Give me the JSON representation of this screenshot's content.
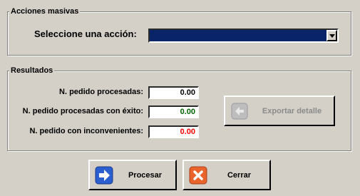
{
  "acciones": {
    "group_title": "Acciones masivas",
    "select_label": "Seleccione una acción:",
    "select_value": ""
  },
  "resultados": {
    "group_title": "Resultados",
    "rows": [
      {
        "label": "N. pedido procesadas:",
        "value": "0.00",
        "color": "#000000"
      },
      {
        "label": "N. pedido procesadas con éxito:",
        "value": "0.00",
        "color": "#006400"
      },
      {
        "label": "N. pedido con inconvenientes:",
        "value": "0.00",
        "color": "#ff0000"
      }
    ],
    "export_label": "Exportar detalle"
  },
  "buttons": {
    "process_label": "Procesar",
    "close_label": "Cerrar"
  },
  "colors": {
    "window_bg": "#d4d0c8",
    "select_bg": "#0a246a",
    "process_icon_blue": "#2b5fcf",
    "close_icon_orange": "#e8642a"
  }
}
